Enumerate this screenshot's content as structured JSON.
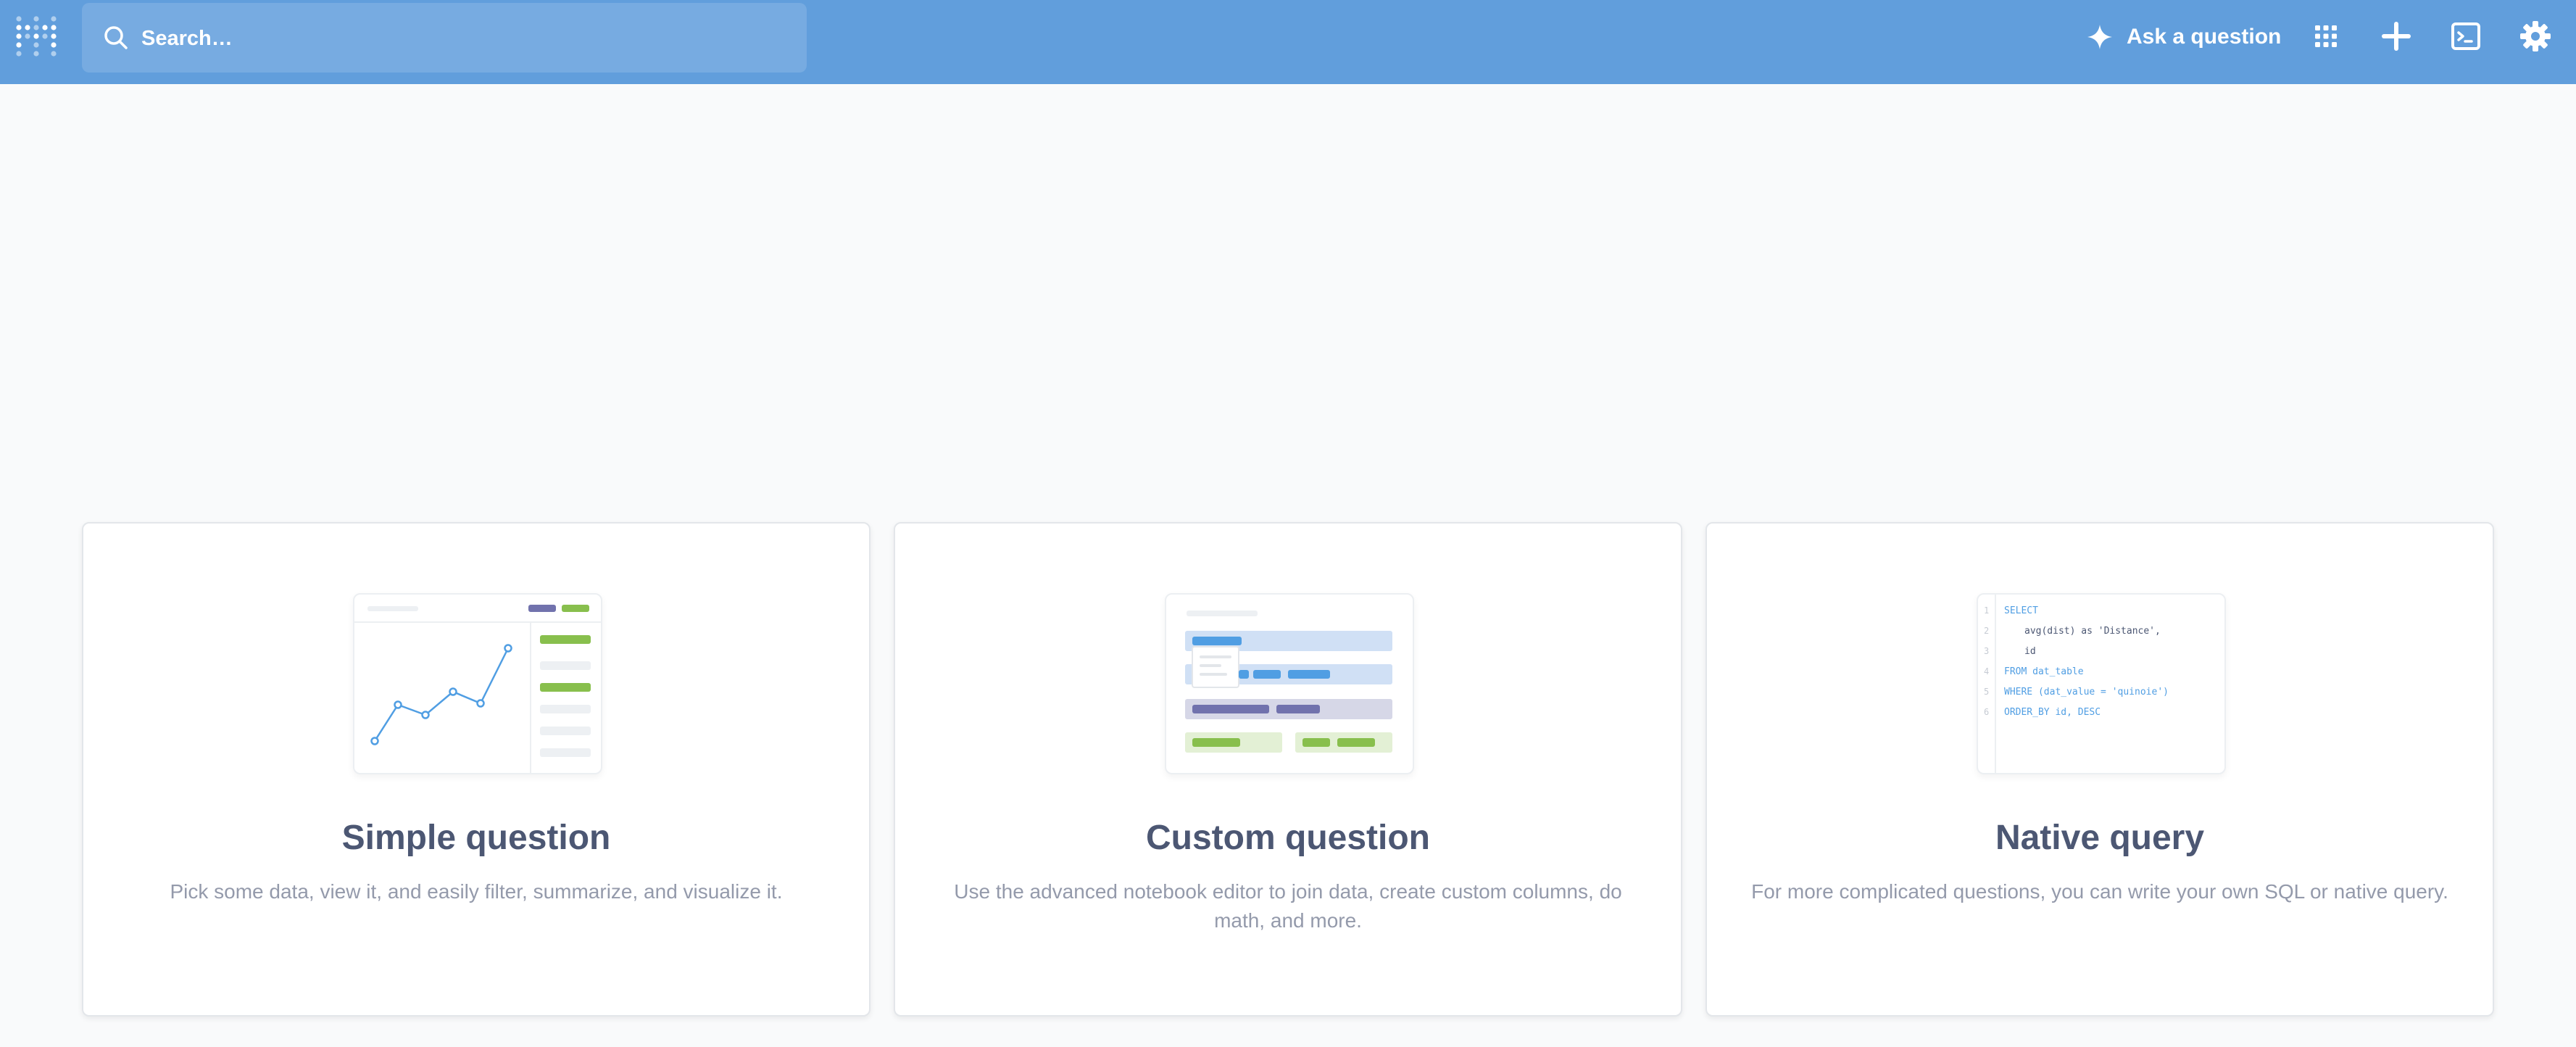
{
  "navbar": {
    "search_placeholder": "Search…",
    "ask_label": "Ask a question",
    "icons": [
      "metabase-logo-icon",
      "search-icon",
      "sparkle-icon",
      "grid-icon",
      "plus-icon",
      "terminal-icon",
      "gear-icon"
    ],
    "color": "#619edc"
  },
  "cards": [
    {
      "title": "Simple question",
      "description": "Pick some data, view it, and easily filter, summarize, and visualize it."
    },
    {
      "title": "Custom question",
      "description": "Use the advanced notebook editor to join data, create custom columns, do math, and more."
    },
    {
      "title": "Native query",
      "description": "For more complicated questions, you can write your own SQL or native query.",
      "code_lines": [
        {
          "num": "1",
          "text": "SELECT"
        },
        {
          "num": "2",
          "text": "avg(dist) as 'Distance',"
        },
        {
          "num": "3",
          "text": "id"
        },
        {
          "num": "4",
          "text": "FROM dat_table"
        },
        {
          "num": "5",
          "text": "WHERE (dat_value = 'quinoie')"
        },
        {
          "num": "6",
          "text": "ORDER_BY id, DESC"
        }
      ]
    }
  ],
  "colors": {
    "brand": "#509ee3",
    "summarize_green": "#88bf4d",
    "filter_purple": "#7172ad",
    "title_text": "#4c5773",
    "desc_text": "#949aab"
  }
}
